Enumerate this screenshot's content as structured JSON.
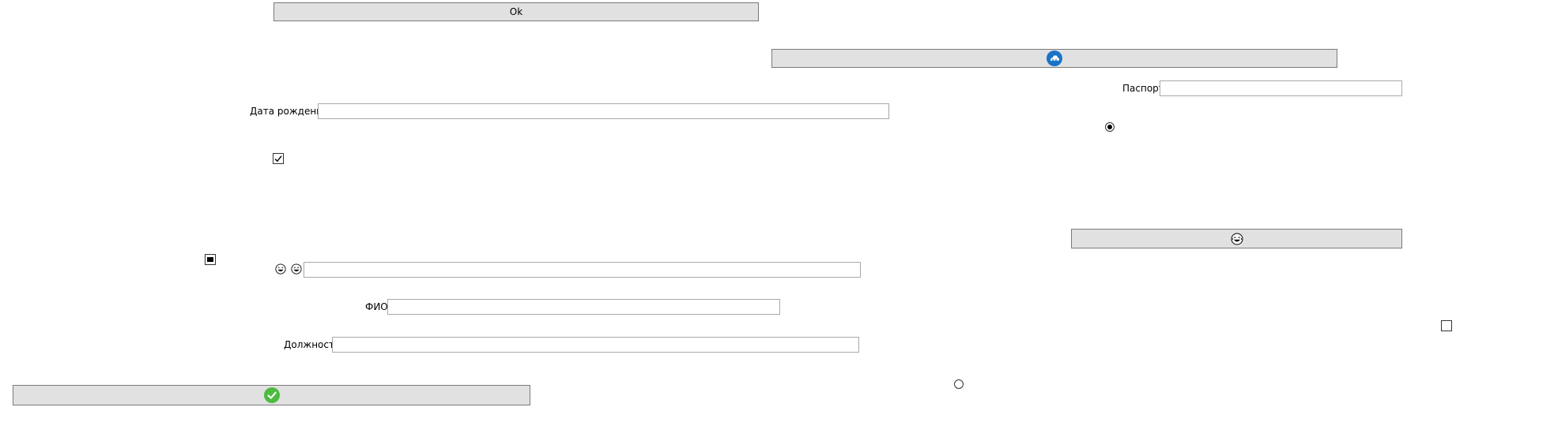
{
  "buttons": {
    "ok_label": "Ok"
  },
  "labels": {
    "passport": "Паспорт",
    "birth_date": "Дата рождения",
    "fio": "ФИО",
    "position": "Должность"
  },
  "fields": {
    "passport": {
      "value": "",
      "placeholder": ""
    },
    "birth_date": {
      "value": "",
      "placeholder": ""
    },
    "emoji_field": {
      "value": "",
      "placeholder": ""
    },
    "fio": {
      "value": "",
      "placeholder": ""
    },
    "position": {
      "value": "",
      "placeholder": ""
    }
  },
  "controls": {
    "checkbox_left_checked": true,
    "checkbox_square_indeterminate": true,
    "checkbox_right_checked": false,
    "radio_top_selected": true,
    "radio_bottom_selected": false
  },
  "icons": {
    "cloud_button_icon": "cloud-icon",
    "laugh_button_icon": "laughing-face-icon",
    "confirm_button_icon": "check-circle-icon",
    "emoji_labels": [
      "laughing-face-icon",
      "grinning-face-icon"
    ]
  },
  "colors": {
    "button_bg": "#e1e1e1",
    "button_border": "#7a7a7a",
    "input_border": "#a9a9a9",
    "cloud_icon_blue": "#1a73c7",
    "check_icon_green": "#4cbb3f"
  }
}
